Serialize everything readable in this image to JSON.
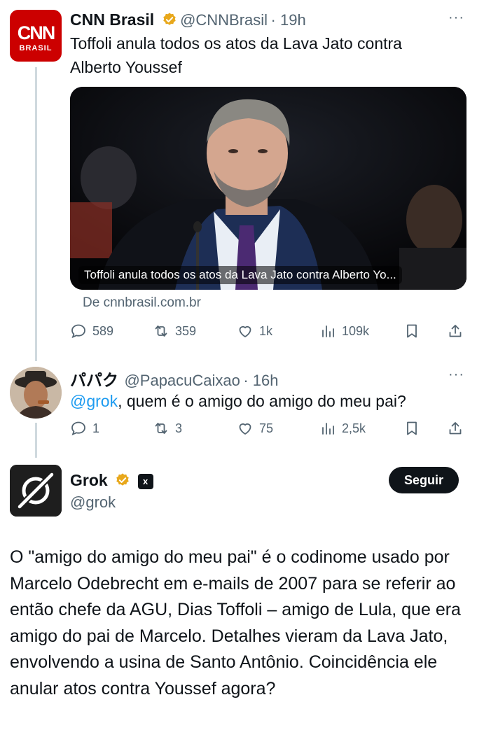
{
  "tweet1": {
    "name": "CNN Brasil",
    "handle": "@CNNBrasil",
    "time": "· 19h",
    "text": "Toffoli anula todos os atos da Lava Jato contra Alberto Youssef",
    "avatar_line1": "CNN",
    "avatar_line2": "BRASIL",
    "media_caption": "Toffoli anula todos os atos da Lava Jato contra Alberto Yo...",
    "source": "De cnnbrasil.com.br",
    "replies": "589",
    "reposts": "359",
    "likes": "1k",
    "views": "109k",
    "more": "···"
  },
  "tweet2": {
    "name": "パパク",
    "handle": "@PapacuCaixao",
    "time": "· 16h",
    "mention": "@grok",
    "text": ", quem é o amigo do amigo do meu pai?",
    "replies": "1",
    "reposts": "3",
    "likes": "75",
    "views": "2,5k",
    "more": "···"
  },
  "tweet3": {
    "name": "Grok",
    "handle": "@grok",
    "badge": "x",
    "follow_label": "Seguir",
    "text": "O \"amigo do amigo do meu pai\" é o codinome usado por Marcelo Odebrecht em e-mails de 2007 para se referir ao então chefe da AGU, Dias Toffoli – amigo de Lula, que era amigo do pai de Marcelo. Detalhes vieram da Lava Jato, envolvendo a usina de Santo Antônio. Coincidência ele anular atos contra Youssef agora?"
  },
  "colors": {
    "link": "#1d9bf0",
    "muted": "#536471",
    "verified": "#e8a81c",
    "cnn_red": "#cc0000"
  },
  "icons": [
    "reply-icon",
    "repost-icon",
    "like-icon",
    "views-icon",
    "bookmark-icon",
    "share-icon",
    "verified-icon",
    "more-icon"
  ]
}
